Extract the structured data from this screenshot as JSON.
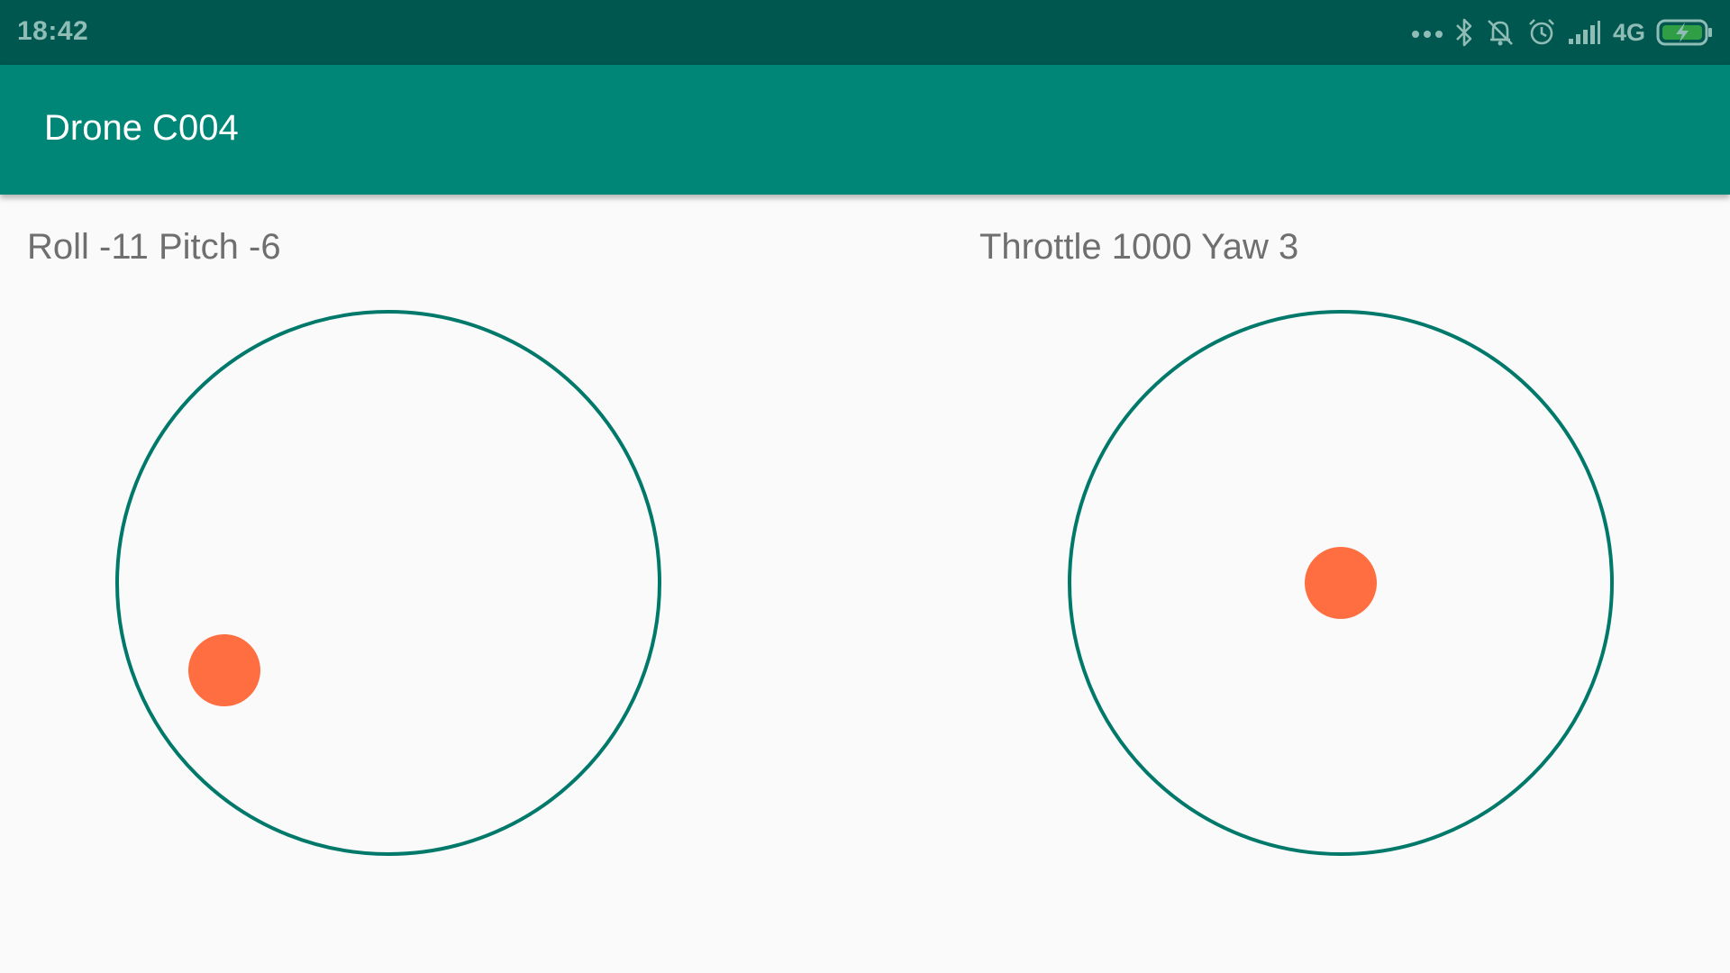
{
  "status_bar": {
    "time": "18:42",
    "network_type": "4G",
    "icons": [
      "more-dots-icon",
      "bluetooth-icon",
      "notifications-off-icon",
      "alarm-icon",
      "signal-icon",
      "battery-charging-icon"
    ]
  },
  "app_bar": {
    "title": "Drone C004"
  },
  "left_stick": {
    "label": "Roll -11 Pitch -6",
    "roll": -11,
    "pitch": -6
  },
  "right_stick": {
    "label": "Throttle 1000 Yaw 3",
    "throttle": 1000,
    "yaw": 3
  },
  "colors": {
    "status_bar": "#00574f",
    "app_bar": "#008676",
    "joystick_ring": "#00796b",
    "joystick_knob": "#ff6e40",
    "label_text": "#6f6f6f"
  }
}
